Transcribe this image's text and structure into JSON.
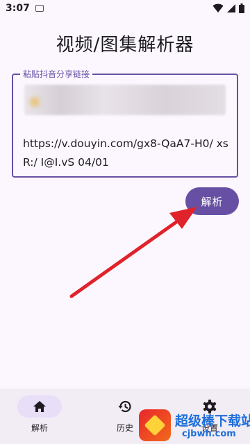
{
  "status_bar": {
    "time": "3:07"
  },
  "app": {
    "title": "视频/图集解析器"
  },
  "input": {
    "label": "粘贴抖音分享链接",
    "value": "https://v.douyin.com/gx8-QaA7-H0/ xsR:/ I@I.vS 04/01"
  },
  "parse_button": {
    "label": "解析"
  },
  "nav": {
    "items": [
      {
        "label": "解析",
        "icon": "home-icon",
        "active": true
      },
      {
        "label": "历史",
        "icon": "history-icon",
        "active": false
      },
      {
        "label": "设置",
        "icon": "settings-icon",
        "active": false
      }
    ]
  },
  "watermark": {
    "title": "超级棒下载站",
    "url": "cjbwh.com"
  },
  "colors": {
    "primary": "#6750a4",
    "background": "#fcf7ff",
    "nav_bg": "#f2ecf5",
    "arrow": "#e0222a"
  }
}
